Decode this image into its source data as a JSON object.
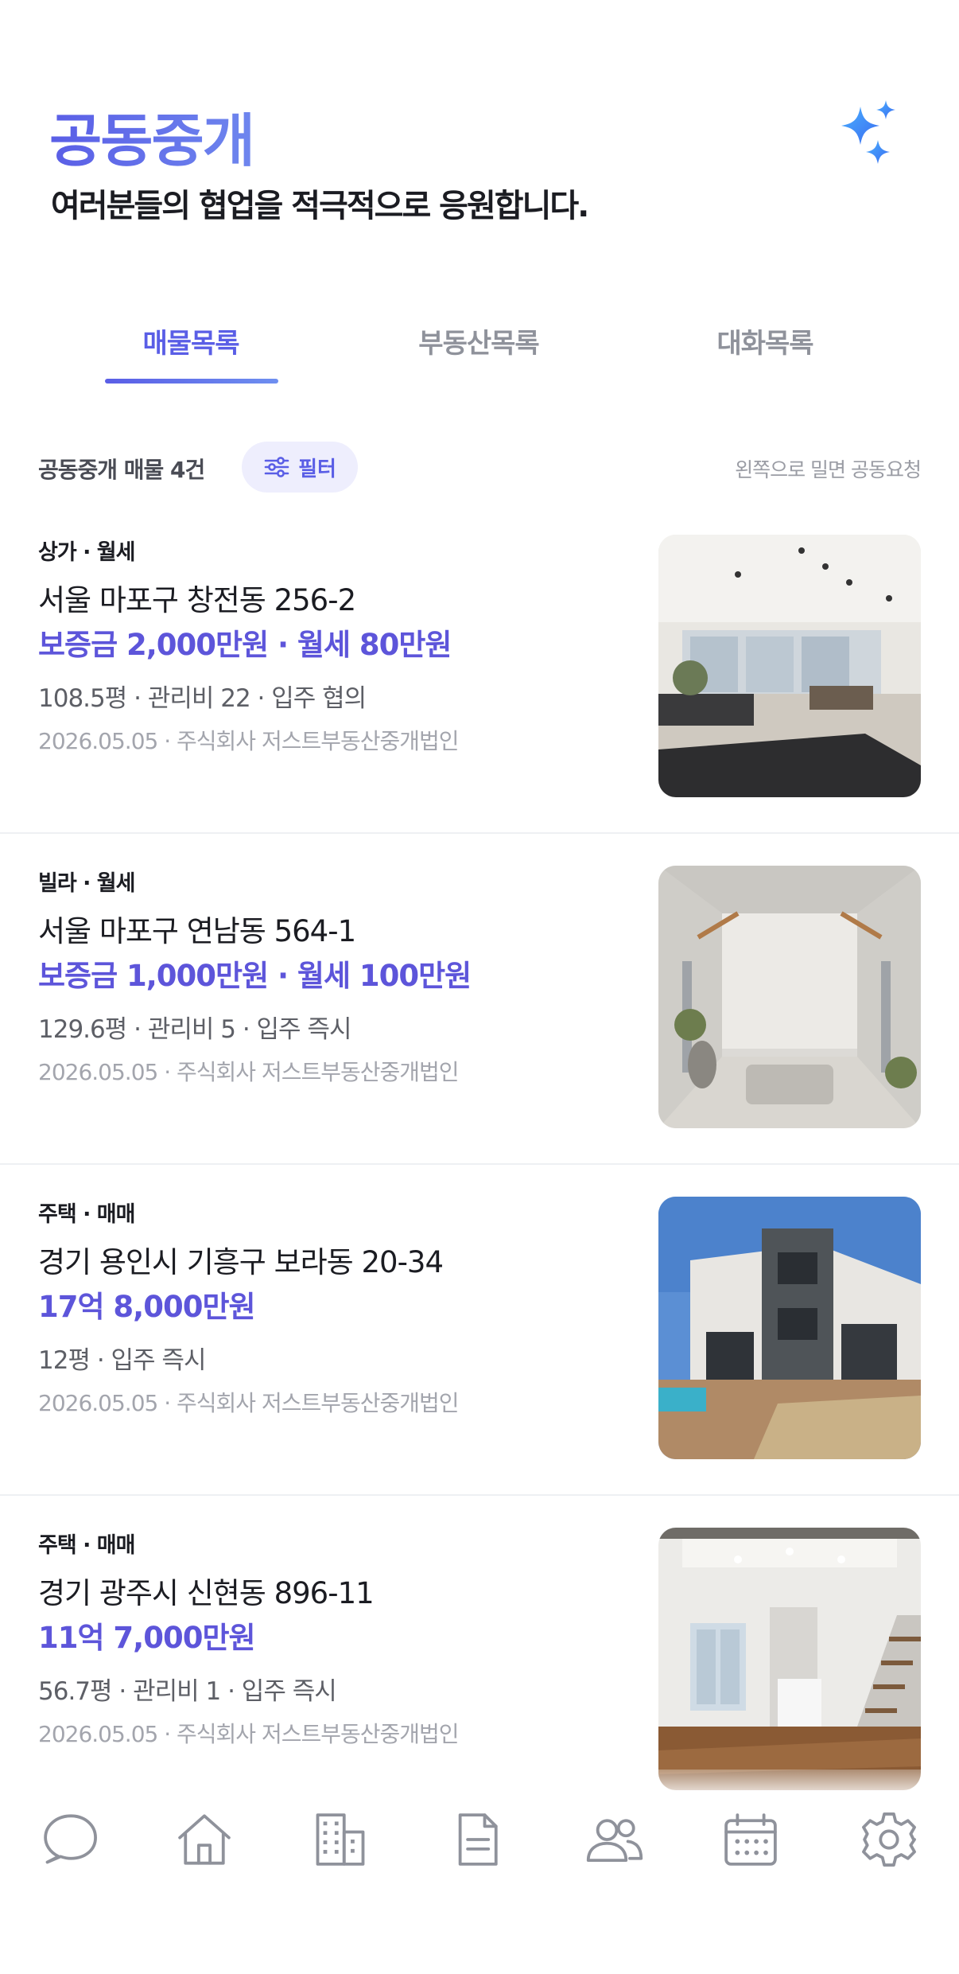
{
  "header": {
    "title": "공동중개",
    "subtitle": "여러분들의 협업을 적극적으로 응원합니다.",
    "icon": "sparkle-icon",
    "accent": "#5a5ee6"
  },
  "tabs": [
    {
      "label": "매물목록",
      "active": true
    },
    {
      "label": "부동산목록",
      "active": false
    },
    {
      "label": "대화목록",
      "active": false
    }
  ],
  "listbar": {
    "count": "공동중개 매물 4건",
    "filter_label": "필터",
    "hint": "왼쪽으로 밀면 공동요청"
  },
  "listings": [
    {
      "category": "상가 · 월세",
      "address": "서울 마포구 창전동 256-2",
      "price": "보증금 2,000만원 · 월세 80만원",
      "meta": "108.5평 · 관리비 22 · 입주 협의",
      "date": "2026.05.05 · 주식회사 저스트부동산중개법인",
      "image": "commercial-interior-photo"
    },
    {
      "category": "빌라 · 월세",
      "address": "서울 마포구 연남동 564-1",
      "price": "보증금 1,000만원 · 월세 100만원",
      "meta": "129.6평 · 관리비 5 · 입주 즉시",
      "date": "2026.05.05 · 주식회사 저스트부동산중개법인",
      "image": "walk-in-closet-photo"
    },
    {
      "category": "주택 · 매매",
      "address": "경기 용인시 기흥구 보라동 20-34",
      "price": "17억 8,000만원",
      "meta": "12평 · 입주 즉시",
      "date": "2026.05.05 · 주식회사 저스트부동산중개법인",
      "image": "house-exterior-photo"
    },
    {
      "category": "주택 · 매매",
      "address": "경기 광주시 신현동 896-11",
      "price": "11억 7,000만원",
      "meta": "56.7평 · 관리비 1 · 입주 즉시",
      "date": "2026.05.05 · 주식회사 저스트부동산중개법인",
      "image": "house-interior-photo"
    }
  ],
  "navbar": {
    "items": [
      "chat-icon",
      "home-icon",
      "building-icon",
      "document-icon",
      "people-icon",
      "calendar-icon",
      "settings-icon"
    ]
  }
}
